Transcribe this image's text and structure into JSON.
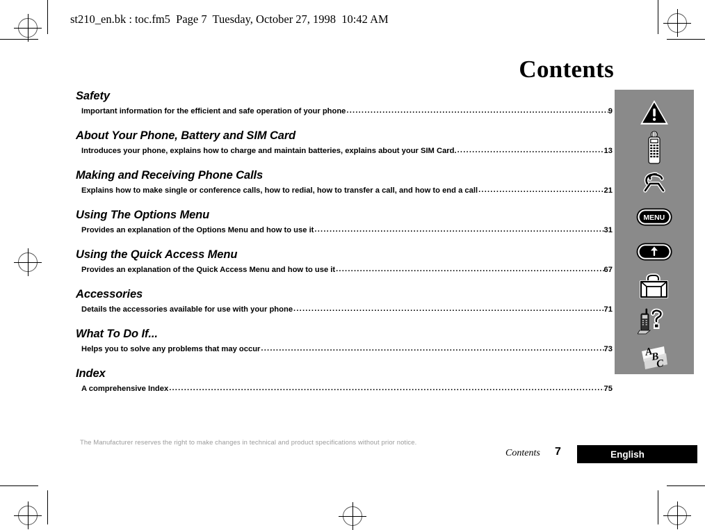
{
  "header": {
    "file_info": "st210_en.bk : toc.fm5  Page 7  Tuesday, October 27, 1998  10:42 AM"
  },
  "page": {
    "title": "Contents"
  },
  "toc": {
    "entries": [
      {
        "heading": "Safety",
        "description": "Important information for the efficient and safe operation of your phone",
        "page": "9"
      },
      {
        "heading": "About Your Phone, Battery and SIM Card",
        "description": "Introduces your phone, explains how to charge and maintain batteries, explains about your SIM Card.",
        "page": "13"
      },
      {
        "heading": "Making and Receiving Phone Calls",
        "description": "Explains how to make single or conference calls, how to redial, how to transfer a call, and how to end a call",
        "page": "21"
      },
      {
        "heading": "Using The Options Menu",
        "description": "Provides an explanation of the Options Menu and how to use it",
        "page": "31"
      },
      {
        "heading": "Using the Quick Access Menu",
        "description": "Provides an explanation of the Quick Access Menu and how to use it",
        "page": "67"
      },
      {
        "heading": "Accessories",
        "description": "Details the accessories available for use with your phone",
        "page": "71"
      },
      {
        "heading": "What To Do If...",
        "description": "Helps you to solve any problems that may occur",
        "page": "73"
      },
      {
        "heading": "Index",
        "description": "A comprehensive Index ",
        "page": "75"
      }
    ],
    "leader_dots": "................................................................................................................................................................................................................................"
  },
  "sidebar": {
    "background_color": "#8a8a8a",
    "icons": [
      {
        "name": "warning-triangle-icon",
        "label": "Safety"
      },
      {
        "name": "mobile-phone-icon",
        "label": "About Your Phone, Battery and SIM Card"
      },
      {
        "name": "ringing-handset-icon",
        "label": "Making and Receiving Phone Calls"
      },
      {
        "name": "menu-button-icon",
        "label": "MENU"
      },
      {
        "name": "up-arrow-button-icon",
        "label": "Using the Quick Access Menu"
      },
      {
        "name": "briefcase-icon",
        "label": "Accessories"
      },
      {
        "name": "phone-question-icon",
        "label": "What To Do If..."
      },
      {
        "name": "abc-index-icon",
        "label": "Index"
      }
    ],
    "menu_button_text": "MENU"
  },
  "footer": {
    "disclaimer": "The Manufacturer reserves the right to make changes in technical and product specifications without prior notice.",
    "chapter": "Contents",
    "page_number": "7",
    "language_tab": "English"
  }
}
